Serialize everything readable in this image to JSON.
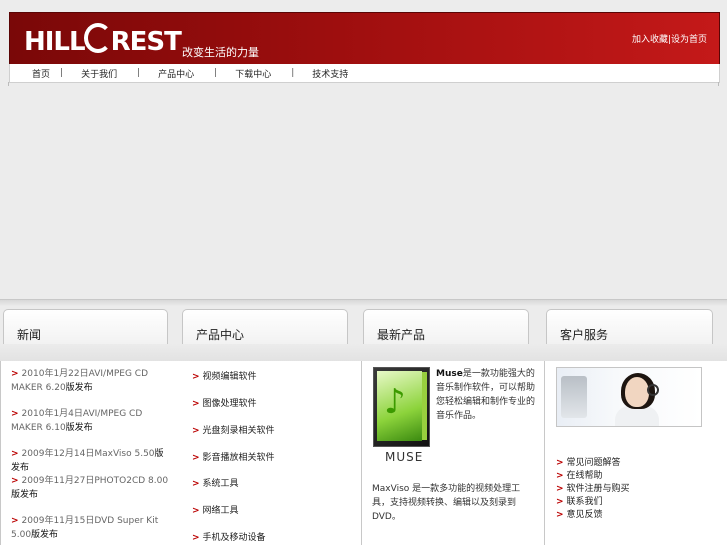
{
  "header": {
    "logo_text_1": "HILL",
    "logo_text_2": "REST",
    "slogan": "改变生活的力量",
    "top_links": "加入收藏|设为首页"
  },
  "nav": {
    "items": [
      {
        "label": "首页"
      },
      {
        "label": "关于我们"
      },
      {
        "label": "产品中心"
      },
      {
        "label": "下载中心"
      },
      {
        "label": "技术支持"
      }
    ],
    "separator": "|"
  },
  "tabs": [
    {
      "label": "新闻"
    },
    {
      "label": "产品中心"
    },
    {
      "label": "最新产品"
    },
    {
      "label": "客户服务"
    }
  ],
  "news": [
    {
      "date": "2010年1月22日",
      "title": "AVI/MPEG CD MAKER 6.20",
      "suffix": "版发布"
    },
    {
      "date": "2010年1月4日",
      "title": "AVI/MPEG CD MAKER 6.10",
      "suffix": "版发布"
    },
    {
      "date": "2009年12月14日",
      "title": "MaxViso 5.50",
      "suffix": "版发布"
    },
    {
      "date": "2009年11月27日",
      "title": "PHOTO2CD 8.00",
      "suffix": "版发布"
    },
    {
      "date": "2009年11月15日",
      "title": "DVD Super Kit 5.00",
      "suffix": "版发布"
    }
  ],
  "products": [
    {
      "label": "视频编辑软件"
    },
    {
      "label": "图像处理软件"
    },
    {
      "label": "光盘刻录相关软件"
    },
    {
      "label": "影音播放相关软件"
    },
    {
      "label": "系统工具"
    },
    {
      "label": "网络工具"
    },
    {
      "label": "手机及移动设备"
    }
  ],
  "latest": {
    "box_label": "MUSE",
    "desc_bold": "Muse",
    "desc_1": "是一款功能强大的音乐制作软件，可以帮助您轻松编辑和制作专业的音乐作品。",
    "desc_2": "MaxViso 是一款多功能的视频处理工具，支持视频转换、编辑以及刻录到DVD。"
  },
  "service": {
    "links": [
      {
        "label": "常见问题解答"
      },
      {
        "label": "在线帮助"
      },
      {
        "label": "软件注册与购买"
      },
      {
        "label": "联系我们"
      },
      {
        "label": "意见反馈"
      }
    ]
  },
  "colors": {
    "header_dark": "#7a0808",
    "header_light": "#c41919",
    "arrow": "#bb0000"
  }
}
